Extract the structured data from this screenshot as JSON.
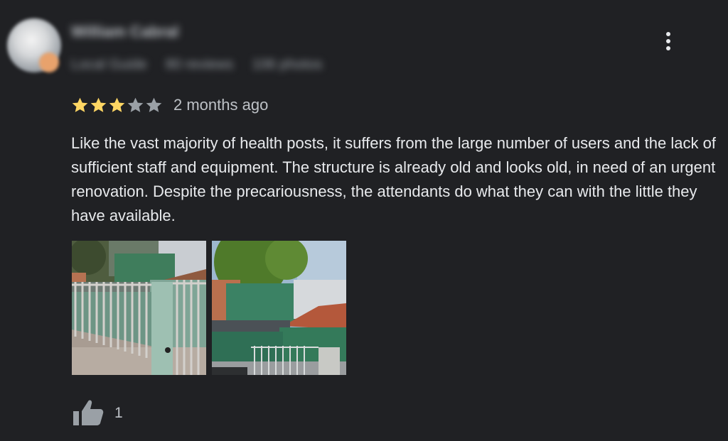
{
  "reviewer": {
    "name": "William Cabral",
    "badge": "Local Guide",
    "reviews": "80 reviews",
    "photos": "106 photos"
  },
  "review": {
    "rating": 3,
    "max_rating": 5,
    "date": "2 months ago",
    "text": "Like the vast majority of health posts, it suffers from the large number of users and the lack of sufficient staff and equipment. The structure is already old and looks old, in need of an urgent renovation. Despite the precariousness, the attendants do what they can with the little they have available."
  },
  "likes": {
    "count": "1"
  },
  "icons": {
    "more": "more-vert-icon",
    "like": "thumb-up-icon",
    "star": "star-icon"
  },
  "colors": {
    "background": "#202124",
    "star_filled": "#fdd663",
    "star_empty": "#9aa0a6",
    "text": "#e8eaed"
  }
}
